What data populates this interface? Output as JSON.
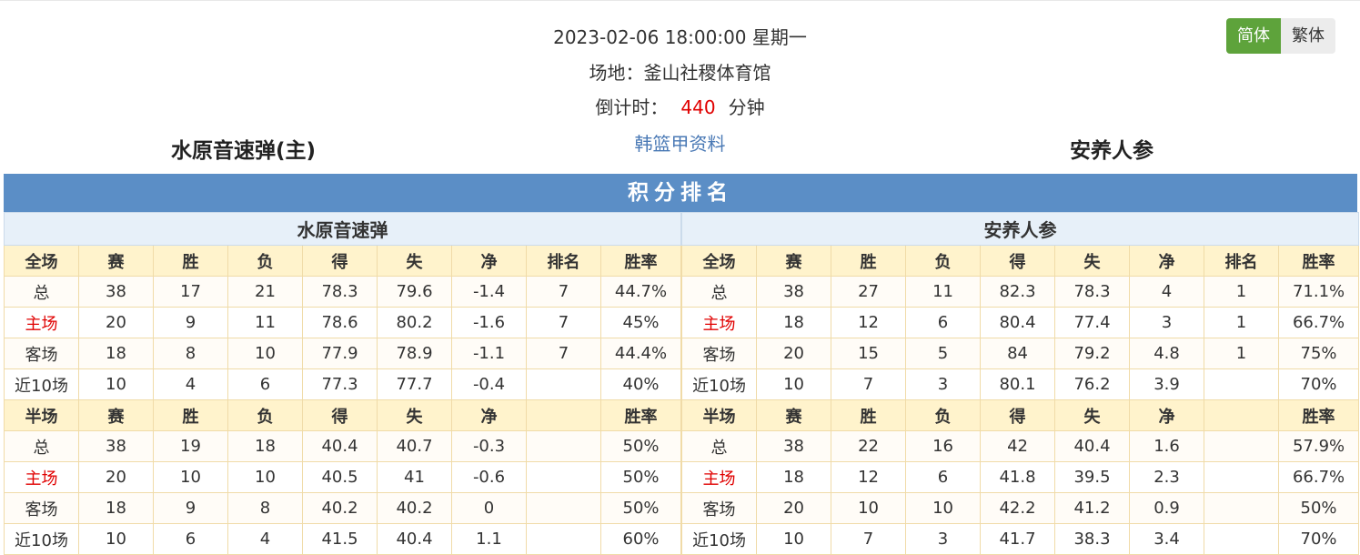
{
  "match": {
    "datetime": "2023-02-06 18:00:00 星期一",
    "venue": "场地：釜山社稷体育馆",
    "countdown_label": "倒计时：",
    "countdown_value": "440",
    "countdown_unit": "分钟",
    "league_link": "韩篮甲资料",
    "home_team": "水原音速弹(主)",
    "away_team": "安养人参"
  },
  "lang": {
    "simplified": "简体",
    "traditional": "繁体"
  },
  "standings": {
    "title": "积分排名",
    "home_name": "水原音速弹",
    "away_name": "安养人参",
    "full_headers": [
      "全场",
      "赛",
      "胜",
      "负",
      "得",
      "失",
      "净",
      "排名",
      "胜率"
    ],
    "half_headers": [
      "半场",
      "赛",
      "胜",
      "负",
      "得",
      "失",
      "净",
      "",
      "胜率"
    ],
    "home_full": [
      [
        "总",
        "38",
        "17",
        "21",
        "78.3",
        "79.6",
        "-1.4",
        "7",
        "44.7%"
      ],
      [
        "主场",
        "20",
        "9",
        "11",
        "78.6",
        "80.2",
        "-1.6",
        "7",
        "45%"
      ],
      [
        "客场",
        "18",
        "8",
        "10",
        "77.9",
        "78.9",
        "-1.1",
        "7",
        "44.4%"
      ],
      [
        "近10场",
        "10",
        "4",
        "6",
        "77.3",
        "77.7",
        "-0.4",
        "",
        "40%"
      ]
    ],
    "home_half": [
      [
        "总",
        "38",
        "19",
        "18",
        "40.4",
        "40.7",
        "-0.3",
        "",
        "50%"
      ],
      [
        "主场",
        "20",
        "10",
        "10",
        "40.5",
        "41",
        "-0.6",
        "",
        "50%"
      ],
      [
        "客场",
        "18",
        "9",
        "8",
        "40.2",
        "40.2",
        "0",
        "",
        "50%"
      ],
      [
        "近10场",
        "10",
        "6",
        "4",
        "41.5",
        "40.4",
        "1.1",
        "",
        "60%"
      ]
    ],
    "away_full": [
      [
        "总",
        "38",
        "27",
        "11",
        "82.3",
        "78.3",
        "4",
        "1",
        "71.1%"
      ],
      [
        "主场",
        "18",
        "12",
        "6",
        "80.4",
        "77.4",
        "3",
        "1",
        "66.7%"
      ],
      [
        "客场",
        "20",
        "15",
        "5",
        "84",
        "79.2",
        "4.8",
        "1",
        "75%"
      ],
      [
        "近10场",
        "10",
        "7",
        "3",
        "80.1",
        "76.2",
        "3.9",
        "",
        "70%"
      ]
    ],
    "away_half": [
      [
        "总",
        "38",
        "22",
        "16",
        "42",
        "40.4",
        "1.6",
        "",
        "57.9%"
      ],
      [
        "主场",
        "18",
        "12",
        "6",
        "41.8",
        "39.5",
        "2.3",
        "",
        "66.7%"
      ],
      [
        "客场",
        "20",
        "10",
        "10",
        "42.2",
        "41.2",
        "0.9",
        "",
        "50%"
      ],
      [
        "近10场",
        "10",
        "7",
        "3",
        "41.7",
        "38.3",
        "3.4",
        "",
        "70%"
      ]
    ]
  },
  "colors": {
    "header_blue": "#5b8ec6",
    "lang_active": "#5ea33b",
    "highlight_red": "#e00000",
    "link_blue": "#4a79b5"
  }
}
